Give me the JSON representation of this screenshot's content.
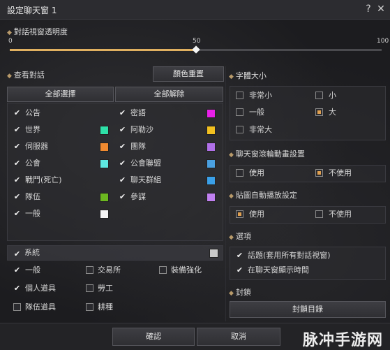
{
  "window": {
    "title": "設定聊天窗 1",
    "help_label": "?",
    "close_label": "✕"
  },
  "opacity": {
    "heading": "對話視窗透明度",
    "tick_min": "0",
    "tick_mid": "50",
    "tick_max": "100",
    "value_percent": 50
  },
  "view": {
    "heading": "查看對話",
    "reset_color_label": "顏色重置",
    "select_all_label": "全部選擇",
    "deselect_all_label": "全部解除",
    "left_items": [
      {
        "label": "公告",
        "checked": true,
        "color": null
      },
      {
        "label": "世界",
        "checked": true,
        "color": "#2ee0a8"
      },
      {
        "label": "伺服器",
        "checked": true,
        "color": "#f08a30"
      },
      {
        "label": "公會",
        "checked": true,
        "color": "#5ee8e0"
      },
      {
        "label": "戰鬥(死亡)",
        "checked": true,
        "color": null
      },
      {
        "label": "隊伍",
        "checked": true,
        "color": "#6cb820"
      },
      {
        "label": "一般",
        "checked": true,
        "color": "#f4f4f4"
      }
    ],
    "right_items": [
      {
        "label": "密語",
        "checked": true,
        "color": "#e820e8"
      },
      {
        "label": "阿勒沙",
        "checked": true,
        "color": "#f2c020"
      },
      {
        "label": "團隊",
        "checked": true,
        "color": "#b070e8"
      },
      {
        "label": "公會聯盟",
        "checked": true,
        "color": "#4aa0e0"
      },
      {
        "label": "聊天群組",
        "checked": true,
        "color": "#3aa0e8"
      },
      {
        "label": "參謀",
        "checked": true,
        "color": "#c080f0"
      }
    ]
  },
  "system": {
    "label": "系統",
    "color": "#c8c8c8",
    "items": [
      {
        "label": "一般",
        "checked": true
      },
      {
        "label": "交易所",
        "checked": false
      },
      {
        "label": "裝備強化",
        "checked": false
      },
      {
        "label": "個人道具",
        "checked": true
      },
      {
        "label": "勞工",
        "checked": false
      },
      {
        "label": "隊伍道具",
        "checked": false
      },
      {
        "label": "耕種",
        "checked": false
      }
    ]
  },
  "font_size": {
    "heading": "字體大小",
    "options": [
      {
        "label": "非常小",
        "selected": false
      },
      {
        "label": "小",
        "selected": false
      },
      {
        "label": "一般",
        "selected": false
      },
      {
        "label": "大",
        "selected": true
      },
      {
        "label": "非常大",
        "selected": false
      }
    ]
  },
  "scroll_anim": {
    "heading": "聊天窗滾輪動畫設置",
    "options": [
      {
        "label": "使用",
        "selected": false
      },
      {
        "label": "不使用",
        "selected": true
      }
    ]
  },
  "auto_play": {
    "heading": "貼圖自動播放設定",
    "options": [
      {
        "label": "使用",
        "selected": true
      },
      {
        "label": "不使用",
        "selected": false
      }
    ]
  },
  "options": {
    "heading": "選項",
    "items": [
      {
        "label": "話題(套用所有對話視窗)",
        "checked": true
      },
      {
        "label": "在聊天窗顯示時間",
        "checked": true
      }
    ]
  },
  "block": {
    "heading": "封鎖",
    "list_label": "封鎖目錄"
  },
  "footer": {
    "confirm_label": "確認",
    "cancel_label": "取消"
  },
  "watermark": "脉冲手游网"
}
